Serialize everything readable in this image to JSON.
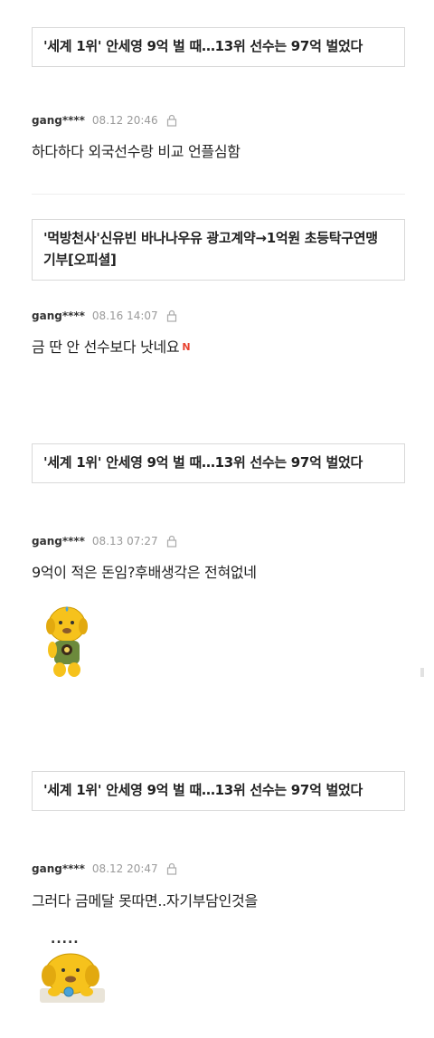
{
  "comments": [
    {
      "article_title": "'세계 1위' 안세영 9억 벌 때…13위 선수는 97억 벌었다",
      "user": "gang****",
      "time": "08.12 20:46",
      "text": "하다하다 외국선수랑 비교 언플심함"
    },
    {
      "article_title": "'먹방천사'신유빈 바나나우유 광고계약→1억원 초등탁구연맹 기부[오피셜]",
      "user": "gang****",
      "time": "08.16 14:07",
      "text": "금 딴 안 선수보다 낫네요",
      "badge": "N"
    },
    {
      "article_title": "'세계 1위' 안세영 9억 벌 때…13위 선수는 97억 벌었다",
      "user": "gang****",
      "time": "08.13 07:27",
      "text": "9억이 적은 돈임?후배생각은 전혀없네",
      "sticker": "thinking-character-sticker"
    },
    {
      "article_title": "'세계 1위' 안세영 9억 벌 때…13위 선수는 97억 벌었다",
      "user": "gang****",
      "time": "08.12 20:47",
      "text": "그러다 금메달 못따면..자기부담인것을",
      "sticker": "speechless-character-sticker",
      "sticker_text": "....."
    }
  ],
  "colors": {
    "border": "#d9d9d9",
    "time": "#9a9a9a",
    "badge": "#e8422f",
    "sticker_yellow": "#f6c21c"
  }
}
